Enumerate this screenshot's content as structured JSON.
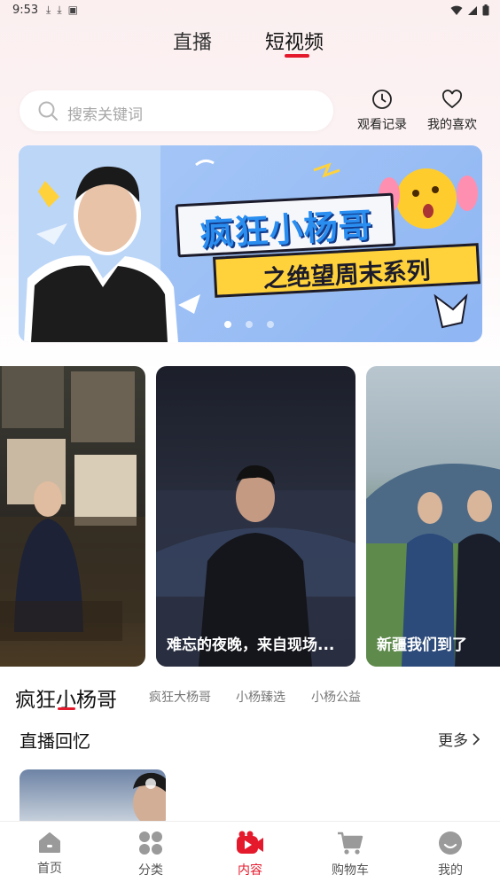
{
  "status_bar": {
    "time": "9:53"
  },
  "top_tabs": {
    "live": "直播",
    "short_video": "短视频"
  },
  "search": {
    "placeholder": "搜索关键词"
  },
  "quick_actions": {
    "history": "观看记录",
    "favorites": "我的喜欢"
  },
  "banner": {
    "title": "疯狂小杨哥",
    "subtitle": "之绝望周末系列",
    "active_dot": 0,
    "dot_count": 3
  },
  "videos": [
    {
      "caption": ""
    },
    {
      "caption": "难忘的夜晚，来自现场..."
    },
    {
      "caption": "新疆我们到了"
    }
  ],
  "category": {
    "title": "疯狂小杨哥",
    "items": [
      "疯狂大杨哥",
      "小杨臻选",
      "小杨公益"
    ]
  },
  "section": {
    "title": "直播回忆",
    "more": "更多"
  },
  "bottom_nav": [
    {
      "label": "首页",
      "icon": "home-icon"
    },
    {
      "label": "分类",
      "icon": "grid-icon"
    },
    {
      "label": "内容",
      "icon": "video-camera-icon"
    },
    {
      "label": "购物车",
      "icon": "cart-icon"
    },
    {
      "label": "我的",
      "icon": "profile-icon"
    }
  ],
  "colors": {
    "accent": "#e5192c",
    "banner_bg": "#a9c9f7"
  }
}
